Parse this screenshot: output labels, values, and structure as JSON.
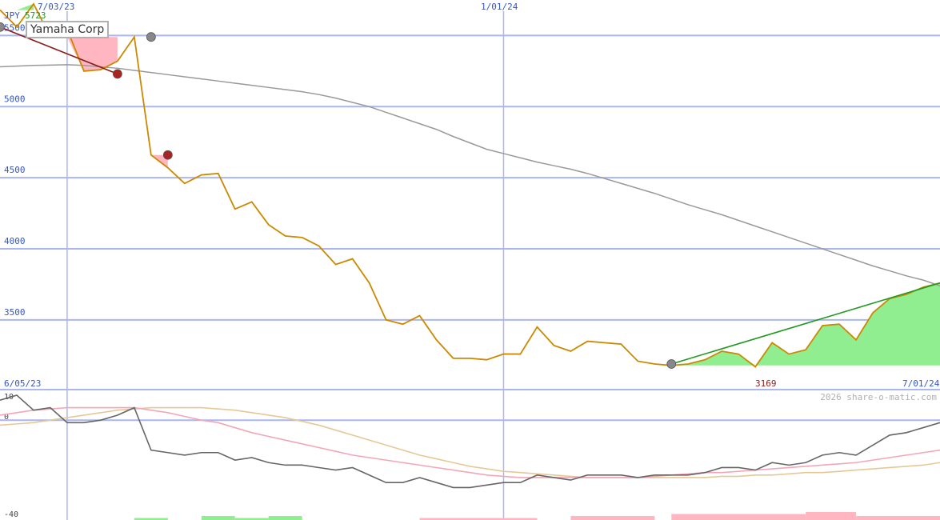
{
  "chart_data": [
    {
      "type": "line",
      "title": "Yamaha Corp",
      "currency": "JPY",
      "x_tick_labels": [
        "7/03/23",
        "1/01/24"
      ],
      "x_range_labels": [
        "6/05/23",
        "7/01/24"
      ],
      "y_ticks": [
        3500,
        4000,
        4500,
        5000,
        5500
      ],
      "ylim": [
        3010,
        5750
      ],
      "grid": true,
      "high_label": "5723",
      "low_label": "3169",
      "watermark": "2026 share-o-matic.com",
      "x": [
        "2023-06-05",
        "2023-06-12",
        "2023-06-19",
        "2023-06-26",
        "2023-07-03",
        "2023-07-10",
        "2023-07-17",
        "2023-07-24",
        "2023-07-31",
        "2023-08-07",
        "2023-08-14",
        "2023-08-21",
        "2023-08-28",
        "2023-09-04",
        "2023-09-11",
        "2023-09-18",
        "2023-09-25",
        "2023-10-02",
        "2023-10-09",
        "2023-10-16",
        "2023-10-23",
        "2023-10-30",
        "2023-11-06",
        "2023-11-13",
        "2023-11-20",
        "2023-11-27",
        "2023-12-04",
        "2023-12-11",
        "2023-12-18",
        "2023-12-25",
        "2024-01-01",
        "2024-01-08",
        "2024-01-15",
        "2024-01-22",
        "2024-01-29",
        "2024-02-05",
        "2024-02-12",
        "2024-02-19",
        "2024-02-26",
        "2024-03-04",
        "2024-03-11",
        "2024-03-18",
        "2024-03-25",
        "2024-04-01",
        "2024-04-08",
        "2024-04-15",
        "2024-04-22",
        "2024-04-29",
        "2024-05-06",
        "2024-05-13",
        "2024-05-20",
        "2024-05-27",
        "2024-06-03",
        "2024-06-10",
        "2024-06-17",
        "2024-06-24",
        "2024-07-01"
      ],
      "series": [
        {
          "name": "Yamaha Corp",
          "color": "#cc8800",
          "values": [
            5680,
            5560,
            5723,
            5490,
            5545,
            5250,
            5260,
            5320,
            5490,
            4660,
            4570,
            4460,
            4520,
            4530,
            4280,
            4330,
            4170,
            4090,
            4080,
            4020,
            3890,
            3930,
            3760,
            3500,
            3470,
            3530,
            3360,
            3230,
            3230,
            3220,
            3260,
            3260,
            3450,
            3320,
            3280,
            3350,
            3340,
            3330,
            3210,
            3190,
            3180,
            3190,
            3220,
            3280,
            3260,
            3170,
            3340,
            3260,
            3290,
            3460,
            3470,
            3360,
            3550,
            3650,
            3680,
            3730,
            3760
          ]
        },
        {
          "color": "#999999",
          "values": [
            5280,
            5285,
            5290,
            5292,
            5295,
            5290,
            5280,
            5270,
            5255,
            5240,
            5225,
            5210,
            5195,
            5180,
            5165,
            5150,
            5135,
            5120,
            5105,
            5085,
            5060,
            5030,
            5000,
            4960,
            4920,
            4880,
            4840,
            4790,
            4745,
            4700,
            4670,
            4640,
            4610,
            4585,
            4560,
            4530,
            4495,
            4460,
            4425,
            4390,
            4350,
            4310,
            4275,
            4240,
            4200,
            4160,
            4120,
            4080,
            4040,
            4000,
            3960,
            3920,
            3880,
            3845,
            3810,
            3780,
            3740
          ]
        }
      ],
      "markers": [
        {
          "x": "2023-06-05",
          "y": 5560,
          "color": "#888888"
        },
        {
          "x": "2023-07-24",
          "y": 5230,
          "color": "#aa2222"
        },
        {
          "x": "2023-08-07",
          "y": 5490,
          "color": "#888888"
        },
        {
          "x": "2023-08-14",
          "y": 4660,
          "color": "#aa2222"
        },
        {
          "x": "2024-03-11",
          "y": 3190,
          "color": "#888888"
        }
      ],
      "trend_lines": [
        {
          "from": [
            "2023-06-05",
            5560
          ],
          "to": [
            "2023-07-24",
            5230
          ],
          "color": "#8b1a1a"
        },
        {
          "from": [
            "2024-03-11",
            3190
          ],
          "to": [
            "2024-07-01",
            3760
          ],
          "color": "#229922"
        }
      ],
      "shaded_regions": [
        {
          "color": "#90ee90",
          "from": "2023-06-05",
          "to": "2023-06-19",
          "type": "above-baseline"
        },
        {
          "color": "#ffb6c1",
          "from": "2023-06-26",
          "to": "2023-07-24",
          "type": "below-baseline"
        },
        {
          "color": "#ffb6c1",
          "from": "2023-08-07",
          "to": "2023-08-14",
          "type": "below-baseline"
        },
        {
          "color": "#90ee90",
          "from": "2024-03-11",
          "to": "2024-07-01",
          "type": "above-baseline"
        }
      ]
    },
    {
      "type": "line",
      "y_ticks": [
        10,
        0,
        -40
      ],
      "ylim": [
        -40,
        10
      ],
      "series": [
        {
          "color": "#666666",
          "values": [
            8,
            10,
            4,
            5,
            -1,
            -1,
            0,
            2,
            5,
            -12,
            -13,
            -14,
            -13,
            -13,
            -16,
            -15,
            -17,
            -18,
            -18,
            -19,
            -20,
            -19,
            -22,
            -25,
            -25,
            -23,
            -25,
            -27,
            -27,
            -26,
            -25,
            -25,
            -22,
            -23,
            -24,
            -22,
            -22,
            -22,
            -23,
            -22,
            -22,
            -22,
            -21,
            -19,
            -19,
            -20,
            -17,
            -18,
            -17,
            -14,
            -13,
            -14,
            -10,
            -6,
            -5,
            -3,
            -1
          ]
        },
        {
          "color": "#f4a6b8",
          "values": [
            2,
            3,
            4,
            4.5,
            5,
            5,
            5,
            5,
            5,
            4,
            3,
            1.5,
            0,
            -1,
            -3,
            -5,
            -6.5,
            -8,
            -9.5,
            -11,
            -12.5,
            -14,
            -15,
            -16,
            -17,
            -18,
            -19,
            -20,
            -21,
            -22,
            -22.5,
            -23,
            -23,
            -23,
            -23,
            -23,
            -23,
            -23,
            -23,
            -22.5,
            -22,
            -21.5,
            -21,
            -21,
            -20.5,
            -20,
            -19.5,
            -19,
            -18.5,
            -18,
            -17.5,
            -17,
            -16,
            -15,
            -14,
            -13,
            -12
          ]
        },
        {
          "color": "#e6c896",
          "values": [
            -2,
            -1.5,
            -1,
            0,
            1,
            2,
            3,
            4,
            4.5,
            5,
            5,
            5,
            5,
            4.5,
            4,
            3,
            2,
            1,
            -0.5,
            -2,
            -4,
            -6,
            -8,
            -10,
            -12,
            -14,
            -15.5,
            -17,
            -18.5,
            -19.5,
            -20.5,
            -21,
            -21.5,
            -22,
            -22.5,
            -23,
            -23,
            -23,
            -23,
            -23,
            -23,
            -23,
            -23,
            -22.5,
            -22.5,
            -22,
            -22,
            -21.5,
            -21,
            -21,
            -20.5,
            -20,
            -19.5,
            -19,
            -18.5,
            -18,
            -17
          ]
        }
      ],
      "volume_bars": [
        {
          "from": "2023-07-31",
          "to": "2023-08-14",
          "level": 1,
          "color": "#90ee90"
        },
        {
          "from": "2023-08-28",
          "to": "2023-09-11",
          "level": 2,
          "color": "#90ee90"
        },
        {
          "from": "2023-09-11",
          "to": "2023-09-25",
          "level": 1,
          "color": "#90ee90"
        },
        {
          "from": "2023-09-25",
          "to": "2023-10-09",
          "level": 2,
          "color": "#90ee90"
        },
        {
          "from": "2023-11-27",
          "to": "2024-01-15",
          "level": 1,
          "color": "#ffb6c1"
        },
        {
          "from": "2024-01-29",
          "to": "2024-03-04",
          "level": 2,
          "color": "#ffb6c1"
        },
        {
          "from": "2024-03-11",
          "to": "2024-05-06",
          "level": 3,
          "color": "#ffb6c1"
        },
        {
          "from": "2024-05-06",
          "to": "2024-05-27",
          "level": 4,
          "color": "#ffb6c1"
        },
        {
          "from": "2024-05-27",
          "to": "2024-07-01",
          "level": 2,
          "color": "#ffb6c1"
        }
      ]
    }
  ]
}
